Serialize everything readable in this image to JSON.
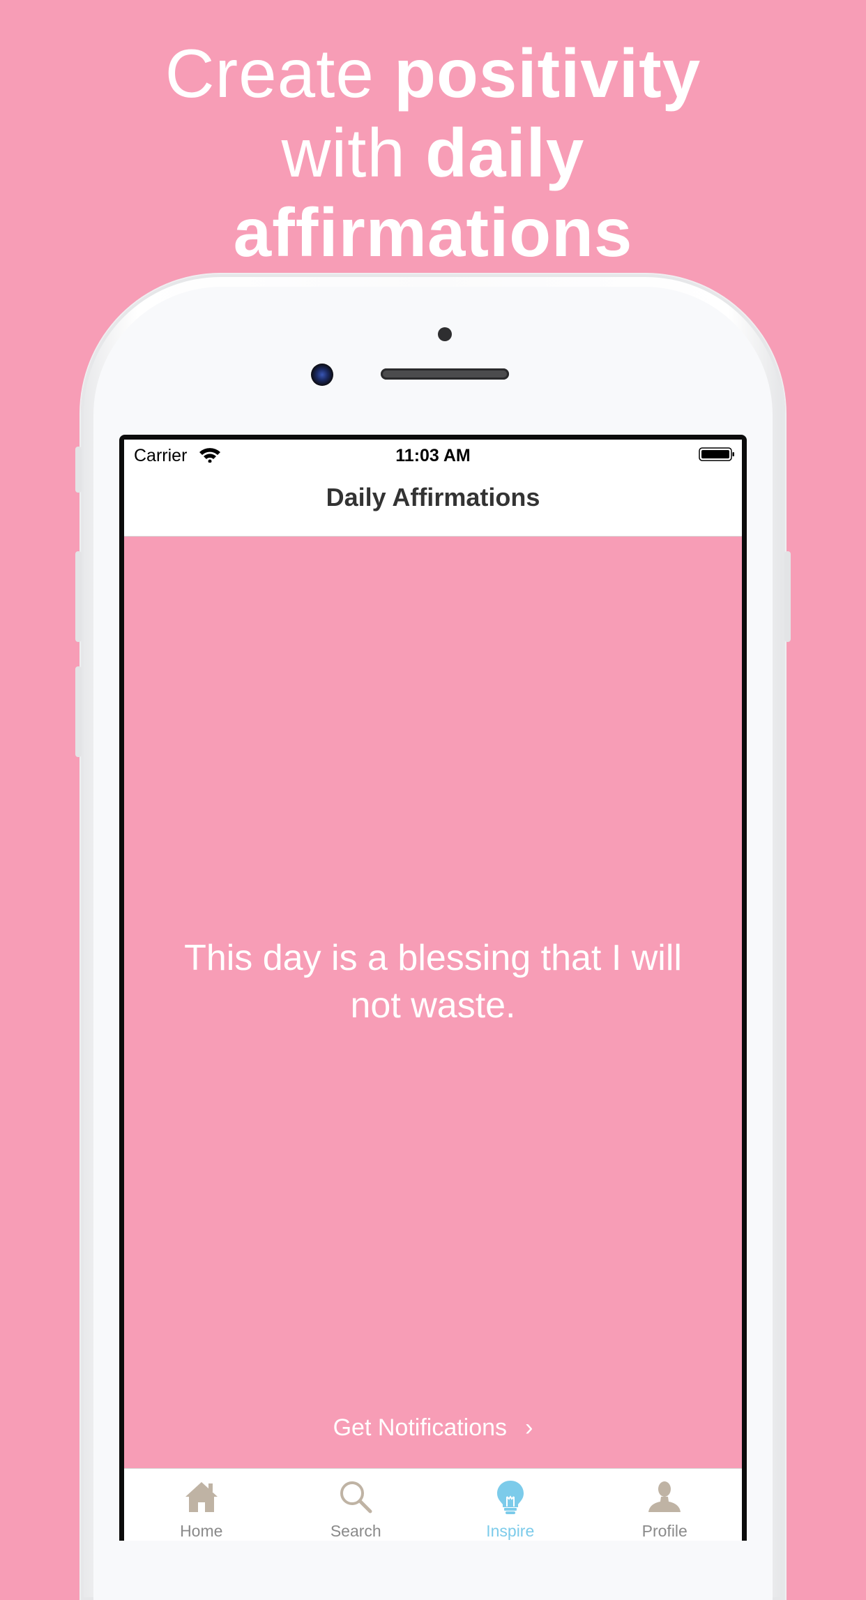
{
  "headline": {
    "line1_light": "Create ",
    "line1_bold": "positivity",
    "line2_light": "with ",
    "line2_bold": "daily",
    "line3_bold": "affirmations"
  },
  "status_bar": {
    "carrier": "Carrier",
    "time": "11:03 AM",
    "wifi_icon": "wifi-icon",
    "battery_icon": "battery-icon"
  },
  "nav": {
    "title": "Daily Affirmations"
  },
  "content": {
    "affirmation": "This day is a blessing that I will not waste.",
    "notifications_label": "Get Notifications",
    "notifications_chevron": "›"
  },
  "tabs": [
    {
      "label": "Home",
      "icon": "home-icon",
      "active": false
    },
    {
      "label": "Search",
      "icon": "search-icon",
      "active": false
    },
    {
      "label": "Inspire",
      "icon": "lightbulb-icon",
      "active": true
    },
    {
      "label": "Profile",
      "icon": "profile-icon",
      "active": false
    }
  ],
  "colors": {
    "background": "#f79db6",
    "active_tab": "#7ccbea",
    "inactive_icon": "#bfb3a4"
  }
}
